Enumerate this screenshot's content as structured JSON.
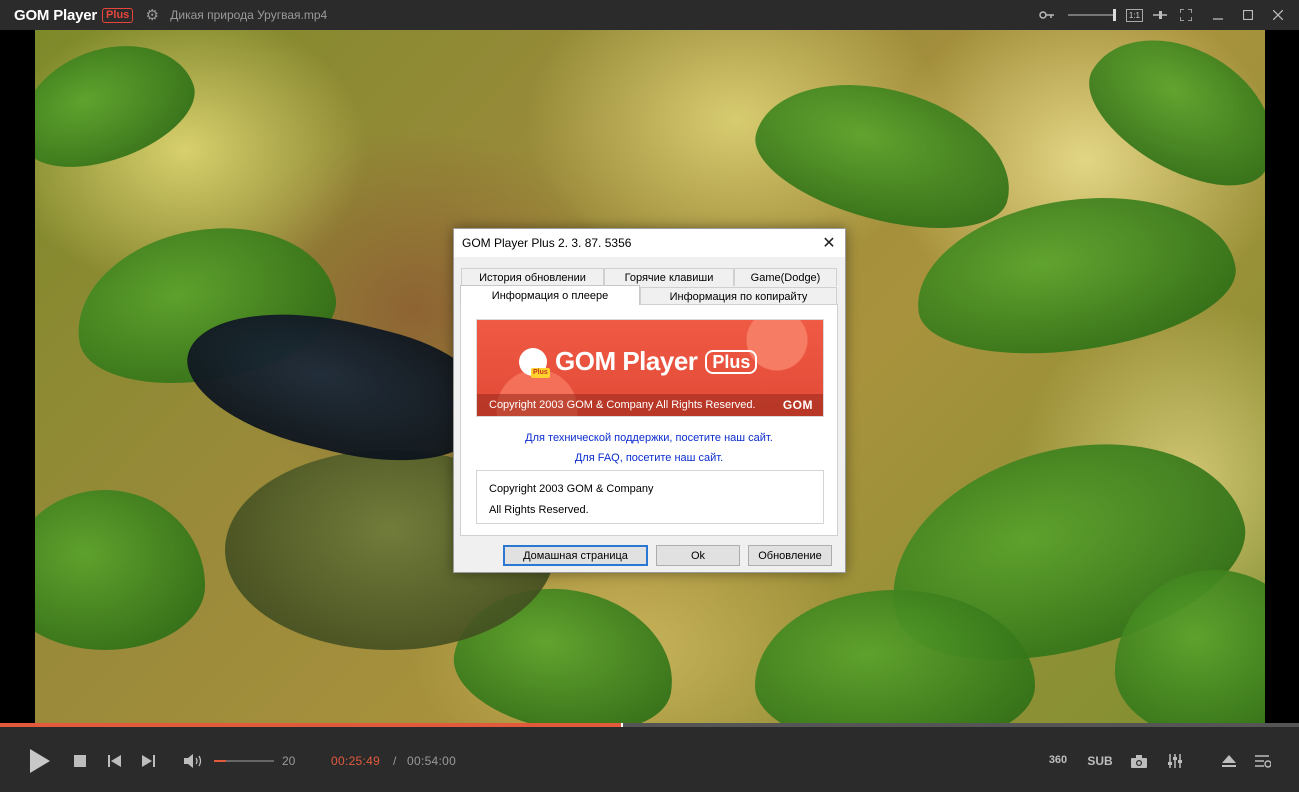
{
  "app": {
    "brand": "GOM Player",
    "brand_badge": "Plus",
    "filename": "Дикая природа Уругвая.mp4",
    "ratio_label": "1:1"
  },
  "dialog": {
    "title": "GOM Player Plus 2. 3. 87. 5356",
    "tabs_back": [
      "История обновлении",
      "Горячие клавиши",
      "Game(Dodge)"
    ],
    "tabs_front": [
      "Информация о плеере",
      "Информация по копирайту"
    ],
    "active_tab": "Информация о плеере",
    "banner": {
      "name": "GOM Player",
      "plus": "Plus",
      "icon_tag": "Plus",
      "copyright": "Copyright 2003 GOM & Company All Rights Reserved.",
      "footer_brand": "GOM"
    },
    "support_link": "Для технической поддержки, посетите наш сайт.",
    "faq_link": "Для FAQ, посетите наш сайт.",
    "copyright_lines": [
      "Copyright 2003 GOM & Company",
      "All Rights Reserved."
    ],
    "buttons": {
      "home": "Домашная страница",
      "ok": "Ok",
      "update": "Обновление"
    }
  },
  "playback": {
    "current_time": "00:25:49",
    "separator": "/",
    "total_time": "00:54:00",
    "volume": "20",
    "volume_fraction": 0.2,
    "progress_fraction": 0.478
  },
  "right_controls": {
    "vr_label": "360",
    "sub_label": "SUB"
  },
  "colors": {
    "accent": "#e25a3c",
    "link": "#0b2ccf",
    "titlebar": "#2b2b2b"
  },
  "icons": [
    "gear-icon",
    "key-icon",
    "pin-icon",
    "fullscreen-icon",
    "minimize-icon",
    "maximize-icon",
    "close-icon",
    "play-icon",
    "stop-icon",
    "prev-icon",
    "next-icon",
    "speaker-icon",
    "camera-icon",
    "equalizer-icon",
    "eject-icon",
    "playlist-icon"
  ]
}
